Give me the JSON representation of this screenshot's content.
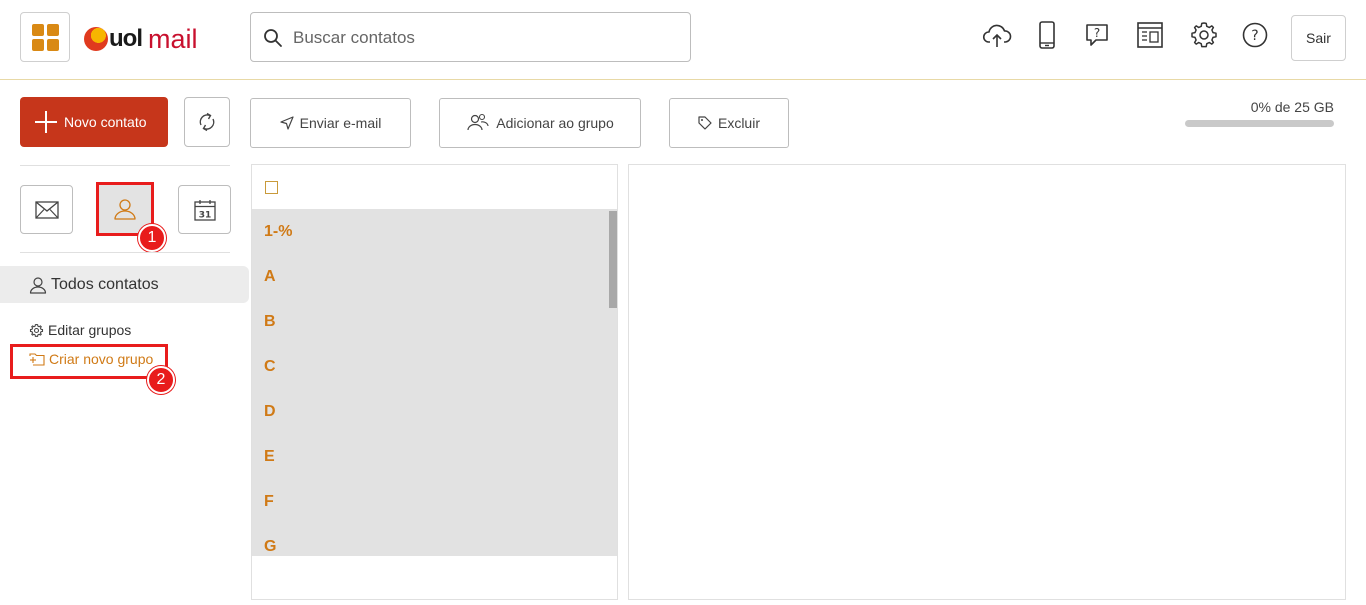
{
  "header": {
    "logo_text_uol": "uol",
    "logo_text_mail": "mail",
    "search": {
      "placeholder": "Buscar contatos",
      "value": ""
    },
    "icons": [
      "cloud-upload-icon",
      "mobile-phone-icon",
      "help-chat-icon",
      "newsletter-icon",
      "gear-icon",
      "help-icon"
    ],
    "logout_label": "Sair"
  },
  "toolbar": {
    "new_contact_label": "Novo contato",
    "send_email_label": "Enviar e-mail",
    "add_to_group_label": "Adicionar ao grupo",
    "delete_label": "Excluir"
  },
  "quota": {
    "text": "0% de 25 GB",
    "used_fraction": 0.0
  },
  "sidebar": {
    "apps": [
      "mail-icon",
      "contacts-icon",
      "calendar-icon"
    ],
    "calendar_day": "31",
    "all_contacts_label": "Todos contatos",
    "edit_groups_label": "Editar grupos",
    "create_group_label": "Criar novo grupo"
  },
  "annotations": {
    "badge_1": "1",
    "badge_2": "2"
  },
  "contact_list": {
    "letters": [
      "1-%",
      "A",
      "B",
      "C",
      "D",
      "E",
      "F",
      "G"
    ]
  },
  "colors": {
    "brand_red": "#c6361b",
    "accent_orange": "#d07a16",
    "highlight_red": "#e81c1c"
  }
}
